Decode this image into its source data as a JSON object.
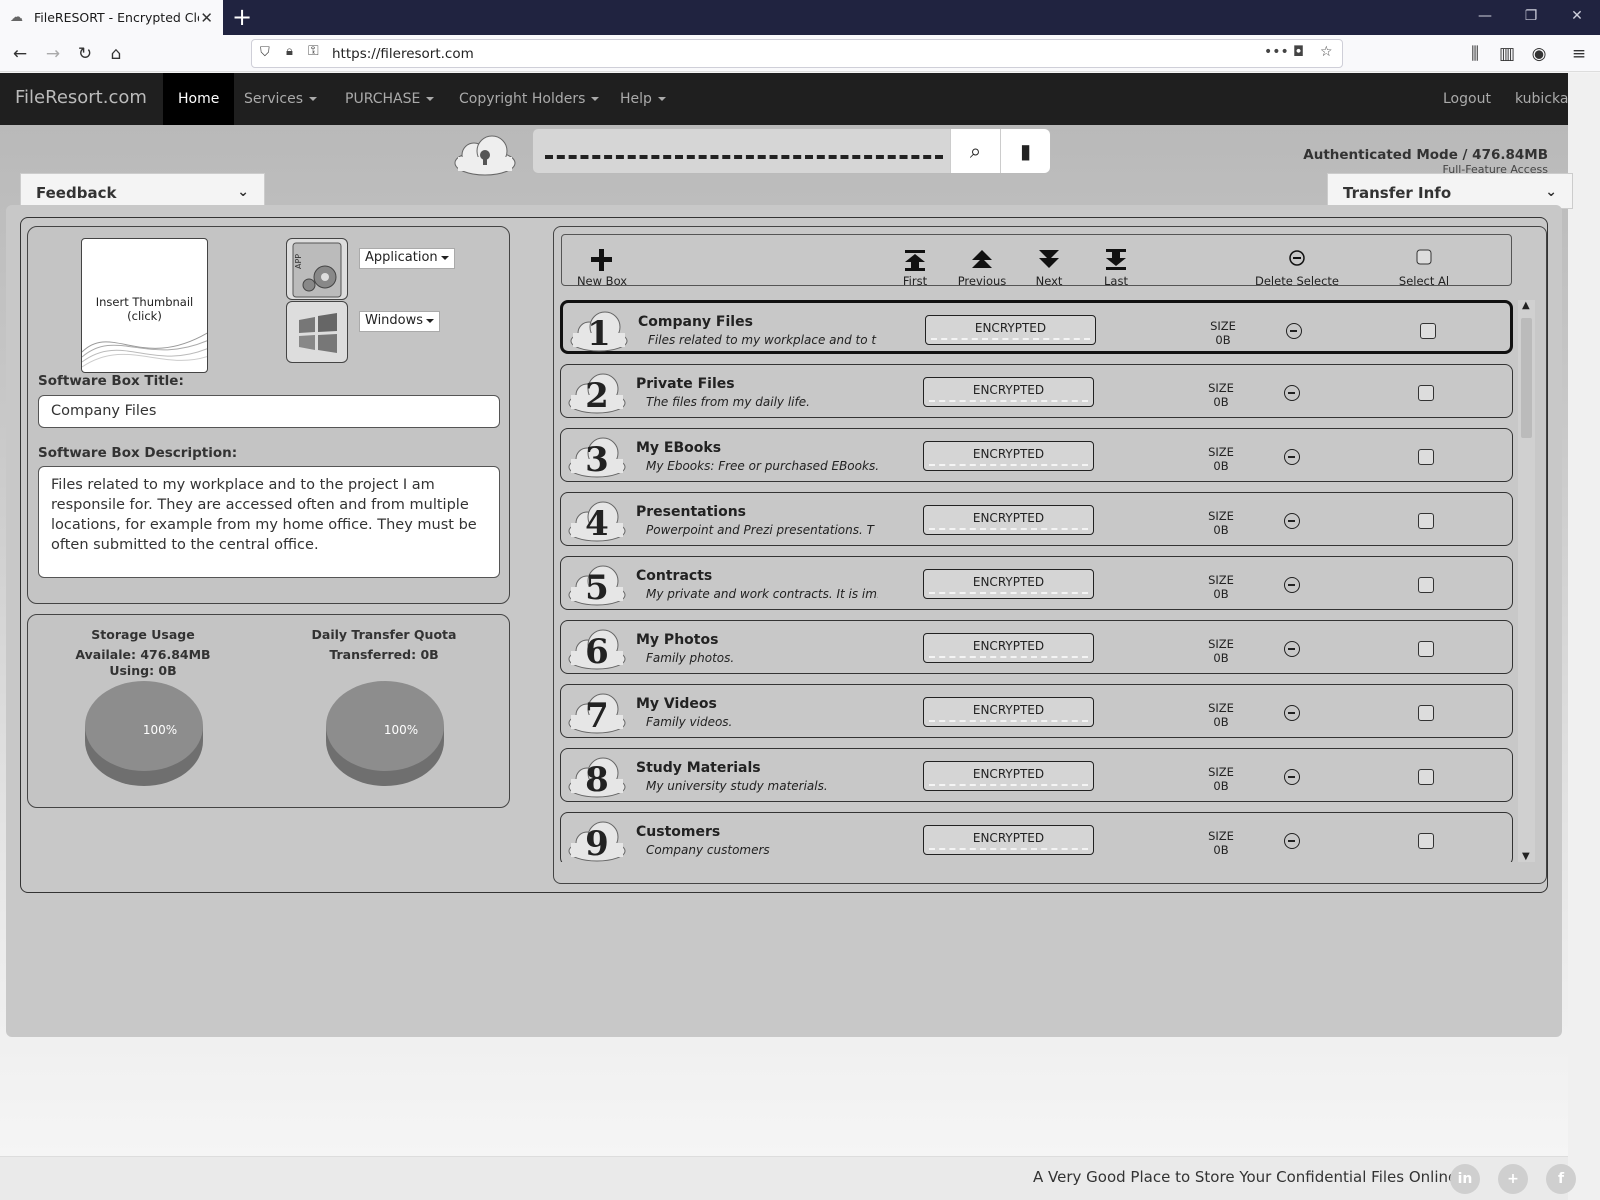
{
  "browser": {
    "tab_title": "FileRESORT - Encrypted Cloud F",
    "url": "https://fileresort.com"
  },
  "site": {
    "brand": "FileResort.com",
    "nav": [
      "Home",
      "Services",
      "PURCHASE",
      "Copyright Holders",
      "Help"
    ],
    "logout": "Logout",
    "user": "kubicka"
  },
  "header": {
    "auth_mode": "Authenticated Mode / 476.84MB",
    "auth_sub": "Full-Feature Access"
  },
  "panels": {
    "feedback": "Feedback",
    "transfer_info": "Transfer Info"
  },
  "editor": {
    "thumbnail_label": "Insert Thumbnail (click)",
    "type_select": "Application",
    "os_select": "Windows",
    "title_label": "Software Box Title:",
    "title_value": "Company Files",
    "desc_label": "Software Box Description:",
    "desc_value": "Files related to my workplace and to the project I am responsile for. They are accessed often and from multiple locations, for example from my home office. They must be often submitted to the central office."
  },
  "stats": {
    "storage_title": "Storage Usage",
    "storage_available": "Availale: 476.84MB",
    "storage_using": "Using: 0B",
    "storage_pct": "100%",
    "quota_title": "Daily Transfer Quota",
    "quota_transferred": "Transferred: 0B",
    "quota_pct": "100%"
  },
  "toolbar": {
    "new_box": "New Box",
    "first": "First",
    "previous": "Previous",
    "next": "Next",
    "last": "Last",
    "delete_selected": "Delete Selecte",
    "select_all": "Select Al"
  },
  "boxes": [
    {
      "num": "1",
      "name": "Company Files",
      "desc": "Files related to my workplace and to t ...",
      "status": "ENCRYPTED",
      "size_label": "SIZE",
      "size": "0B"
    },
    {
      "num": "2",
      "name": "Private Files",
      "desc": "The files from my daily life.",
      "status": "ENCRYPTED",
      "size_label": "SIZE",
      "size": "0B"
    },
    {
      "num": "3",
      "name": "My EBooks",
      "desc": "My Ebooks: Free or purchased EBooks...",
      "status": "ENCRYPTED",
      "size_label": "SIZE",
      "size": "0B"
    },
    {
      "num": "4",
      "name": "Presentations",
      "desc": "Powerpoint and Prezi presentations. T ...",
      "status": "ENCRYPTED",
      "size_label": "SIZE",
      "size": "0B"
    },
    {
      "num": "5",
      "name": "Contracts",
      "desc": "My private and work contracts. It is im...",
      "status": "ENCRYPTED",
      "size_label": "SIZE",
      "size": "0B"
    },
    {
      "num": "6",
      "name": "My Photos",
      "desc": "Family photos.",
      "status": "ENCRYPTED",
      "size_label": "SIZE",
      "size": "0B"
    },
    {
      "num": "7",
      "name": "My Videos",
      "desc": "Family videos.",
      "status": "ENCRYPTED",
      "size_label": "SIZE",
      "size": "0B"
    },
    {
      "num": "8",
      "name": "Study Materials",
      "desc": "My university study materials.",
      "status": "ENCRYPTED",
      "size_label": "SIZE",
      "size": "0B"
    },
    {
      "num": "9",
      "name": "Customers",
      "desc": "Company customers",
      "status": "ENCRYPTED",
      "size_label": "SIZE",
      "size": "0B"
    }
  ],
  "footer": {
    "tagline": "A Very Good Place to Store Your Confidential Files Online",
    "social": [
      "in",
      "+",
      "f"
    ]
  }
}
